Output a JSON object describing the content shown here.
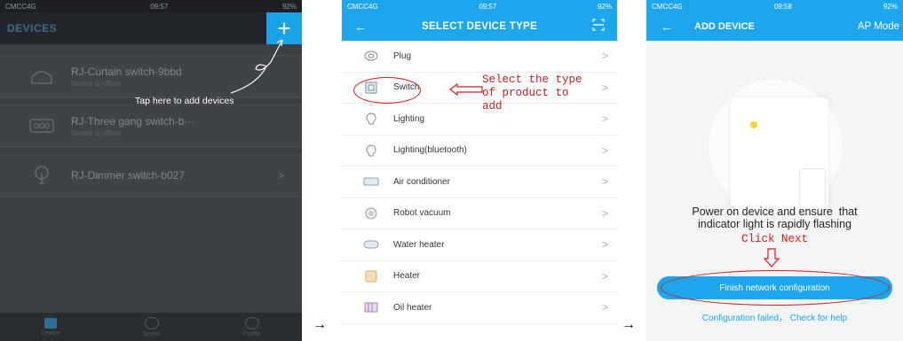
{
  "status": {
    "carrier": "CMCC4G",
    "time1": "09:57",
    "time2": "09:57",
    "time3": "09:58",
    "battery": "92%"
  },
  "screen1": {
    "title": "DEVICES",
    "add_button": "+",
    "devices": [
      {
        "name": "RJ-Curtain switch-9bbd",
        "status": "Device is offline"
      },
      {
        "name": "RJ-Three gang switch-b···",
        "status": "Device is offline"
      },
      {
        "name": "RJ-Dimmer switch-b027",
        "status": ""
      }
    ],
    "tip": "Tap here to add devices",
    "tabs": [
      {
        "label": "Device"
      },
      {
        "label": "Scene"
      },
      {
        "label": "Profile"
      }
    ]
  },
  "screen2": {
    "title": "SELECT DEVICE TYPE",
    "items": [
      {
        "label": "Plug",
        "icon": "plug-icon"
      },
      {
        "label": "Switch",
        "icon": "switch-icon"
      },
      {
        "label": "Lighting",
        "icon": "bulb-icon"
      },
      {
        "label": "Lighting(bluetooth)",
        "icon": "bluetooth-bulb-icon"
      },
      {
        "label": "Air conditioner",
        "icon": "air-conditioner-icon"
      },
      {
        "label": "Robot vacuum",
        "icon": "robot-vacuum-icon"
      },
      {
        "label": "Water heater",
        "icon": "water-heater-icon"
      },
      {
        "label": "Heater",
        "icon": "heater-icon"
      },
      {
        "label": "Oil heater",
        "icon": "oil-heater-icon"
      }
    ],
    "annotation": "Select the type\nof product to\nadd"
  },
  "screen3": {
    "title": "ADD DEVICE",
    "mode": "AP Mode",
    "instruction": "Power on device and ensure  that\nindicator light is rapidly flashing",
    "annotation": "Click Next",
    "button": "Finish network configuration",
    "help": "Configuration failed， Check for help"
  },
  "arrows": [
    "→",
    "→"
  ]
}
